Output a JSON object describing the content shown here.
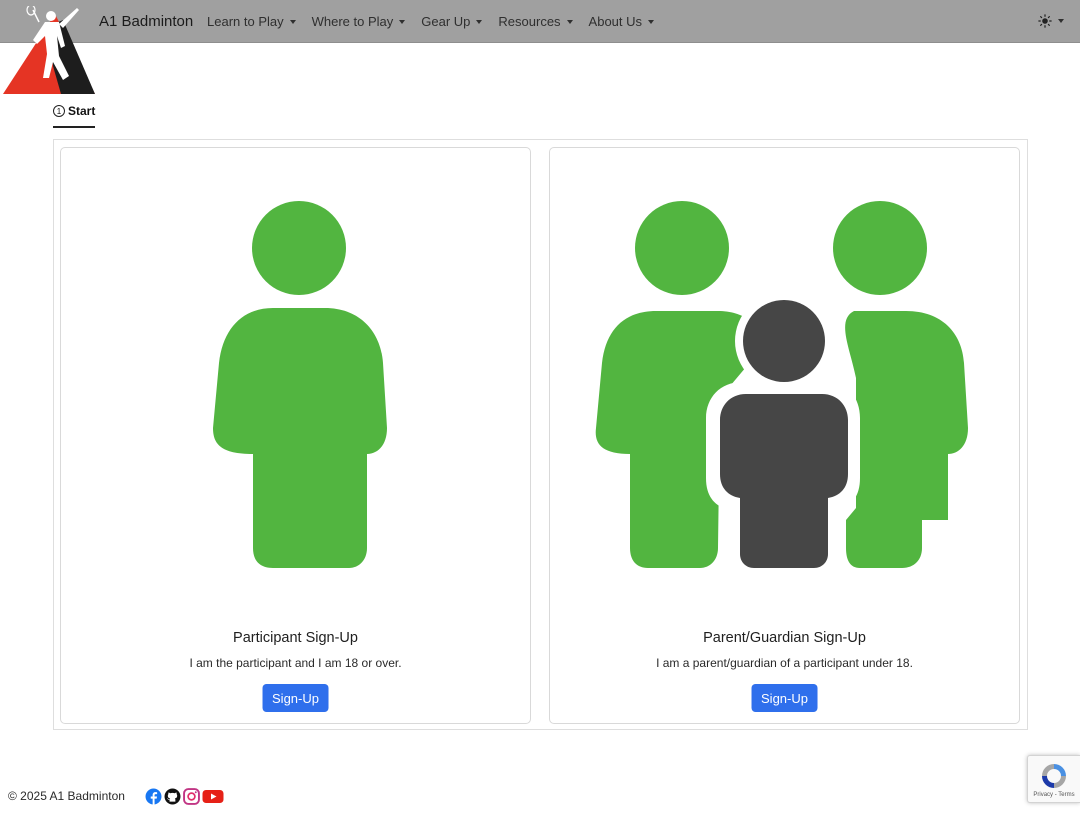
{
  "navbar": {
    "brand": "A1 Badminton",
    "items": [
      {
        "label": "Learn to Play"
      },
      {
        "label": "Where to Play"
      },
      {
        "label": "Gear Up"
      },
      {
        "label": "Resources"
      },
      {
        "label": "About Us"
      }
    ],
    "theme_icon": "sun-icon"
  },
  "steps": {
    "current_number": "1",
    "current_label": "Start"
  },
  "cards": [
    {
      "title": "Participant Sign-Up",
      "text": "I am the participant and I am 18 or over.",
      "button": "Sign-Up",
      "icon": "person-icon"
    },
    {
      "title": "Parent/Guardian Sign-Up",
      "text": "I am a parent/guardian of a participant under 18.",
      "button": "Sign-Up",
      "icon": "family-icon"
    }
  ],
  "footer": {
    "copyright": "© 2025 A1 Badminton",
    "socials": [
      "facebook-icon",
      "github-icon",
      "instagram-icon",
      "youtube-icon"
    ]
  },
  "recaptcha": {
    "links": "Privacy - Terms"
  },
  "colors": {
    "navbar": "#a0a0a0",
    "figure_green": "#52b540",
    "figure_dark": "#464646",
    "button": "#2f6fec",
    "logo_red": "#e53424"
  }
}
